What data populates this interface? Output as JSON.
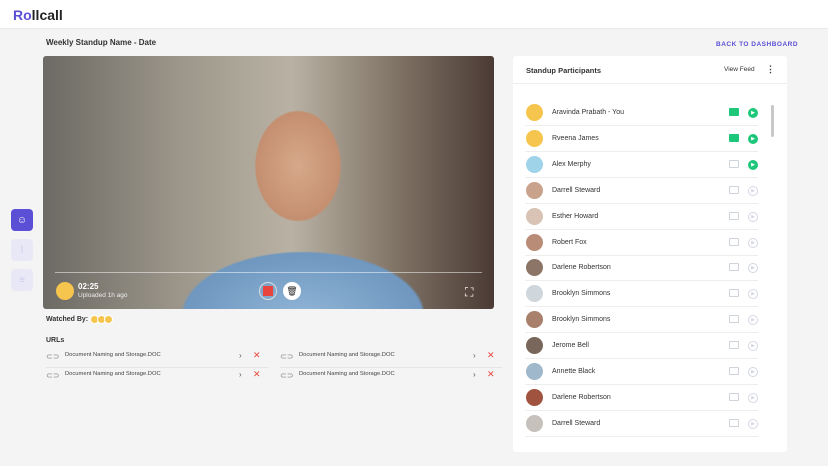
{
  "app": {
    "logo": "Rollcall",
    "back_label": "BACK TO DASHBOARD",
    "page_title": "Weekly Standup Name - Date"
  },
  "video": {
    "time": "02:25",
    "uploaded": "Uploaded 1h ago"
  },
  "watched_label": "Watched By:",
  "urls_label": "URLs",
  "urls": [
    "Document Naming and Storage.DOC",
    "Document Naming and Storage.DOC",
    "Document Naming and Storage.DOC",
    "Document Naming and Storage.DOC"
  ],
  "panel": {
    "title": "Standup Participants",
    "view_feed": "View Feed"
  },
  "participants": [
    {
      "name": "Aravinda Prabath - You",
      "folder": true,
      "played": true,
      "color": "#f6c54d"
    },
    {
      "name": "Rveena James",
      "folder": true,
      "played": true,
      "color": "#f6c54d"
    },
    {
      "name": "Alex Merphy",
      "folder": false,
      "played": true,
      "color": "#9fd3ea"
    },
    {
      "name": "Darrell Steward",
      "folder": false,
      "played": false,
      "color": "#c9a28c"
    },
    {
      "name": "Esther Howard",
      "folder": false,
      "played": false,
      "color": "#d8c3b5"
    },
    {
      "name": "Robert Fox",
      "folder": false,
      "played": false,
      "color": "#b98c77"
    },
    {
      "name": "Darlene Robertson",
      "folder": false,
      "played": false,
      "color": "#8c7566"
    },
    {
      "name": "Brooklyn Simmons",
      "folder": false,
      "played": false,
      "color": "#cfd6dc"
    },
    {
      "name": "Brooklyn Simmons",
      "folder": false,
      "played": false,
      "color": "#a8806b"
    },
    {
      "name": "Jerome Bell",
      "folder": false,
      "played": false,
      "color": "#7a675c"
    },
    {
      "name": "Annette Black",
      "folder": false,
      "played": false,
      "color": "#9fb8cc"
    },
    {
      "name": "Darlene Robertson",
      "folder": false,
      "played": false,
      "color": "#a0533f"
    },
    {
      "name": "Darrell Steward",
      "folder": false,
      "played": false,
      "color": "#c7c1bb"
    }
  ],
  "colors": {
    "accent": "#5b4fd6",
    "green": "#1cc77a",
    "red": "#e8463c"
  }
}
